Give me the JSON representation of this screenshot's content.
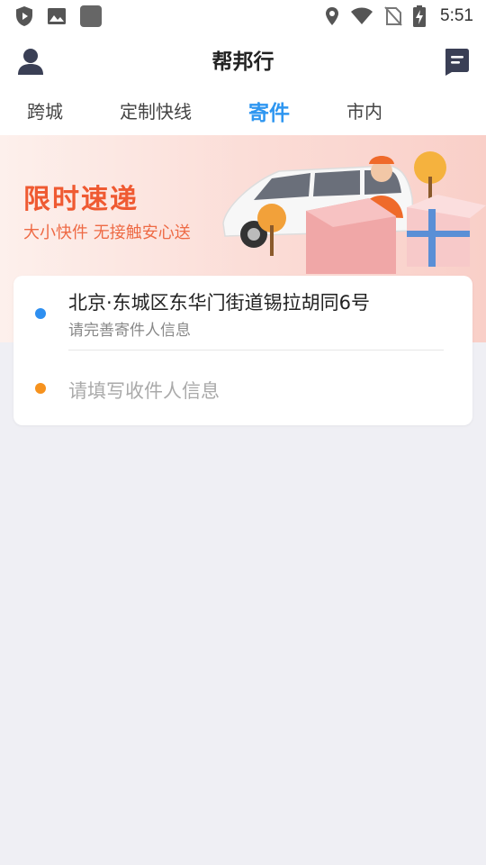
{
  "status_bar": {
    "time": "5:51",
    "icons": [
      "shield-play-icon",
      "image-icon",
      "app-square-icon",
      "location-icon",
      "wifi-icon",
      "no-sim-icon",
      "battery-charging-icon"
    ]
  },
  "header": {
    "title": "帮邦行",
    "left_icon": "user-avatar-icon",
    "right_icon": "message-icon"
  },
  "tabs": [
    {
      "label": "跨城",
      "active": false
    },
    {
      "label": "定制快线",
      "active": false
    },
    {
      "label": "寄件",
      "active": true
    },
    {
      "label": "市内",
      "active": false
    }
  ],
  "banner": {
    "title": "限时速递",
    "subtitle": "大小快件 无接触安心送"
  },
  "card": {
    "sender_address": "北京·东城区东华门街道锡拉胡同6号",
    "sender_hint": "请完善寄件人信息",
    "receiver_placeholder": "请填写收件人信息"
  },
  "colors": {
    "accent": "#2e96f0",
    "sender_dot": "#2e8ff0",
    "receiver_dot": "#f6921e",
    "banner_text": "#ef5a32"
  }
}
